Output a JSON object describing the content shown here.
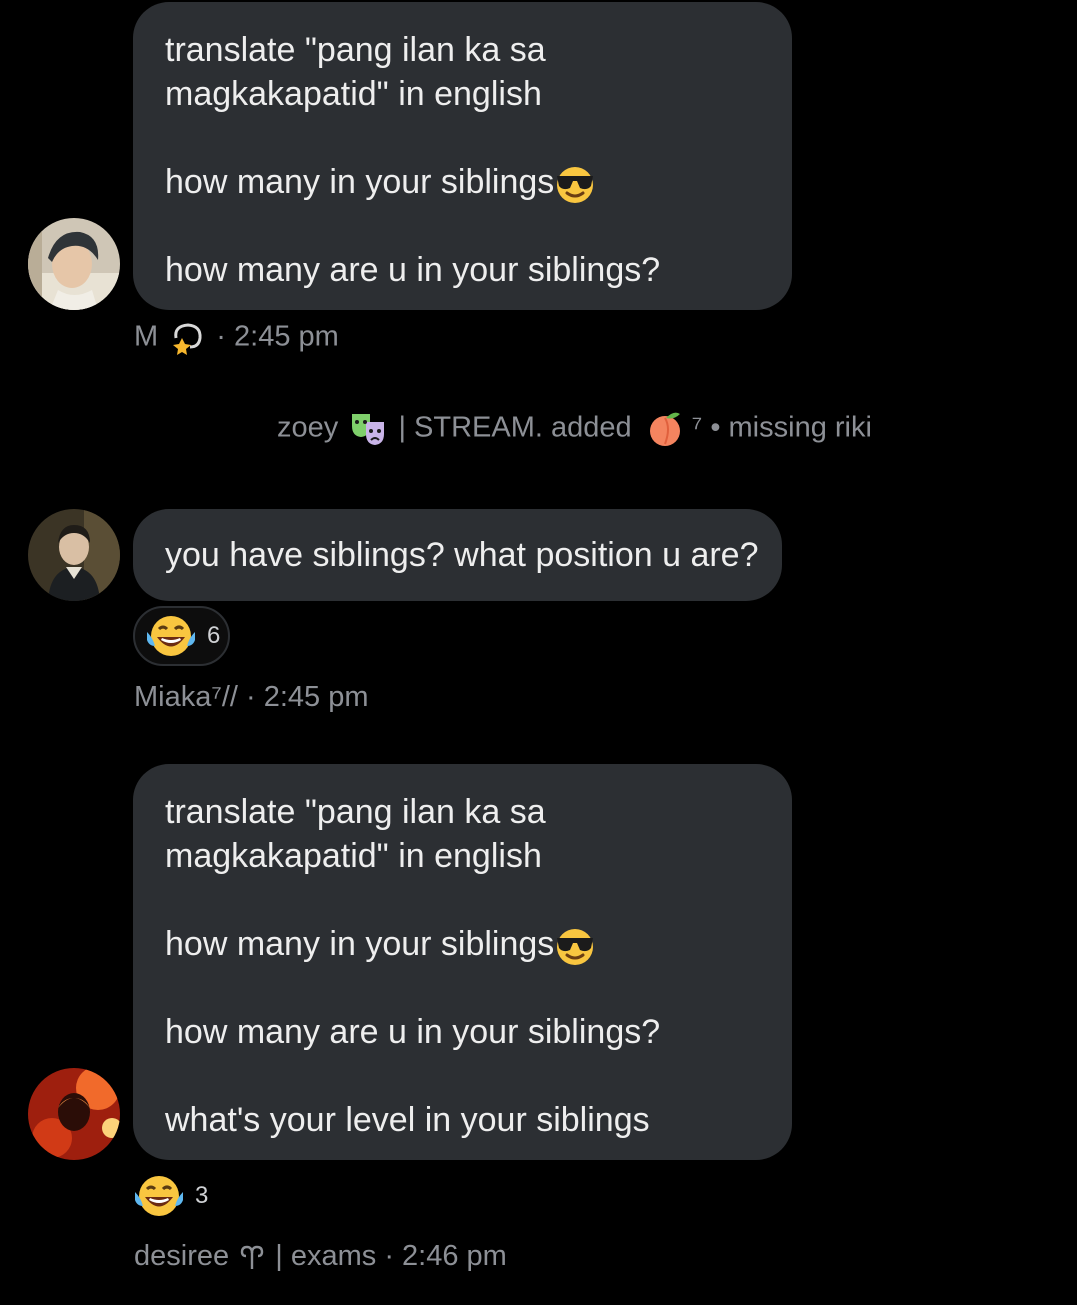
{
  "messages": [
    {
      "lines": [
        "translate \"pang ilan ka sa",
        "magkakapatid\" in english",
        "",
        "how many in your siblings",
        "",
        "how many are u in your siblings?"
      ],
      "author": "M",
      "time": "· 2:45 pm",
      "author_icon": "dizzy-star-icon",
      "line_icon": "sunglasses-face-icon"
    },
    {
      "lines": [
        "you have siblings? what position u are?"
      ],
      "reaction": {
        "emoji": "tears-of-joy-icon",
        "count": "6"
      },
      "author": "Miaka⁷//",
      "time": "· 2:45 pm"
    },
    {
      "lines": [
        "translate \"pang ilan ka sa",
        "magkakapatid\" in english",
        "",
        "how many in your siblings",
        "",
        "how many are u in your siblings?",
        "",
        "what's your level in your siblings"
      ],
      "reaction": {
        "emoji": "tears-of-joy-icon",
        "count": "3"
      },
      "author": "desiree",
      "author_suffix": "| exams",
      "time": "· 2:46 pm",
      "author_icon": "aries-icon",
      "line_icon": "sunglasses-face-icon"
    }
  ],
  "system_message": {
    "actor": "zoey",
    "actor_suffix": "| STREAM. added",
    "target_suffix": "⁷ • missing riki",
    "actor_icon": "performing-arts-icon",
    "target_icon": "peach-icon"
  },
  "colors": {
    "background": "#000000",
    "bubble": "#2c2f33",
    "text": "#eeeeee",
    "meta": "#8d9096"
  }
}
